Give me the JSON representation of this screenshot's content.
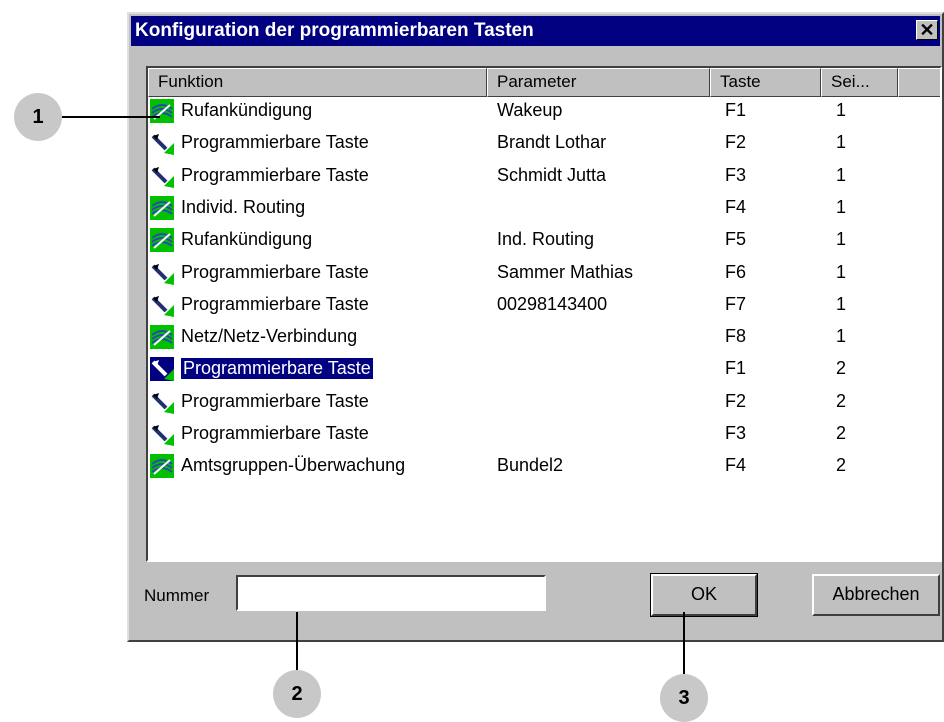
{
  "dialog": {
    "title": "Konfiguration der programmierbaren Tasten",
    "close_label": "✕"
  },
  "columns": [
    "Funktion",
    "Parameter",
    "Taste",
    "Sei..."
  ],
  "rows": [
    {
      "icon": "network-icon",
      "funktion": "Rufankündigung",
      "parameter": "Wakeup",
      "taste": "F1",
      "seite": "1",
      "selected": false
    },
    {
      "icon": "pen-key-icon",
      "funktion": "Programmierbare Taste",
      "parameter": "Brandt Lothar",
      "taste": "F2",
      "seite": "1",
      "selected": false
    },
    {
      "icon": "pen-key-icon",
      "funktion": "Programmierbare Taste",
      "parameter": "Schmidt Jutta",
      "taste": "F3",
      "seite": "1",
      "selected": false
    },
    {
      "icon": "network-icon",
      "funktion": "Individ. Routing",
      "parameter": "",
      "taste": "F4",
      "seite": "1",
      "selected": false
    },
    {
      "icon": "network-icon",
      "funktion": "Rufankündigung",
      "parameter": "Ind. Routing",
      "taste": "F5",
      "seite": "1",
      "selected": false
    },
    {
      "icon": "pen-key-icon",
      "funktion": "Programmierbare Taste",
      "parameter": "Sammer Mathias",
      "taste": "F6",
      "seite": "1",
      "selected": false
    },
    {
      "icon": "pen-key-icon",
      "funktion": "Programmierbare Taste",
      "parameter": "00298143400",
      "taste": "F7",
      "seite": "1",
      "selected": false
    },
    {
      "icon": "network-icon",
      "funktion": "Netz/Netz-Verbindung",
      "parameter": "",
      "taste": "F8",
      "seite": "1",
      "selected": false
    },
    {
      "icon": "pen-key-icon",
      "funktion": "Programmierbare Taste",
      "parameter": "",
      "taste": "F1",
      "seite": "2",
      "selected": true
    },
    {
      "icon": "pen-key-icon",
      "funktion": "Programmierbare Taste",
      "parameter": "",
      "taste": "F2",
      "seite": "2",
      "selected": false
    },
    {
      "icon": "pen-key-icon",
      "funktion": "Programmierbare Taste",
      "parameter": "",
      "taste": "F3",
      "seite": "2",
      "selected": false
    },
    {
      "icon": "network-icon",
      "funktion": "Amtsgruppen-Überwachung",
      "parameter": "Bundel2",
      "taste": "F4",
      "seite": "2",
      "selected": false
    }
  ],
  "nummer": {
    "label": "Nummer",
    "value": ""
  },
  "buttons": {
    "ok": "OK",
    "cancel": "Abbrechen"
  },
  "callouts": [
    "1",
    "2",
    "3"
  ],
  "colors": {
    "selection": "#000080",
    "window": "#c0c0c0",
    "icon_green": "#00c000"
  }
}
